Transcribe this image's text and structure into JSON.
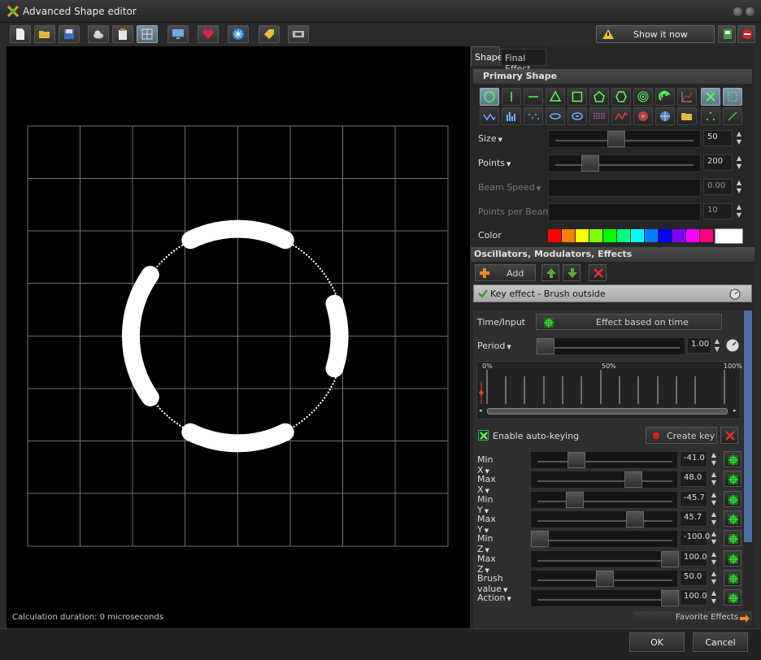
{
  "window": {
    "title": "Advanced Shape editor"
  },
  "toolbar": {
    "buttons": [
      {
        "name": "new-file-icon"
      },
      {
        "name": "open-folder-icon"
      },
      {
        "name": "save-disk-icon"
      },
      {
        "name": "cloud-icon"
      },
      {
        "name": "clipboard-icon"
      },
      {
        "name": "grid-icon"
      },
      {
        "name": "monitor-icon"
      },
      {
        "name": "heart-icon"
      },
      {
        "name": "snowflake-icon"
      },
      {
        "name": "tag-icon"
      },
      {
        "name": "film-icon"
      }
    ],
    "show_label": "Show it now"
  },
  "canvas": {
    "status": "Calculation duration: 0 microseconds"
  },
  "tabs": [
    {
      "label": "Shape"
    },
    {
      "label": "Final Effect"
    }
  ],
  "primary_shape": {
    "header": "Primary Shape",
    "sliders": [
      {
        "label": "Size",
        "value": "50",
        "fraction": 0.45,
        "enabled": true
      },
      {
        "label": "Points",
        "value": "200",
        "fraction": 0.25,
        "enabled": true
      },
      {
        "label": "Beam Speed",
        "value": "0.00",
        "fraction": null,
        "enabled": false
      },
      {
        "label": "Points per Beam",
        "value": "10",
        "fraction": null,
        "enabled": false
      }
    ],
    "color_label": "Color",
    "colors": [
      "#ff0000",
      "#ff7f00",
      "#ffff00",
      "#7fff00",
      "#00ff00",
      "#00ff7f",
      "#00ffff",
      "#007fff",
      "#0000ff",
      "#7f00ff",
      "#ff00ff",
      "#ff007f"
    ],
    "selected_color": "#ffffff"
  },
  "oscillators": {
    "header": "Oscillators, Modulators, Effects",
    "add_label": "Add",
    "effect_item": "Key effect - Brush outside"
  },
  "effect": {
    "time_input_label": "Time/Input",
    "time_mode": "Effect based on time",
    "period_label": "Period",
    "period_value": "1.00",
    "timeline_ticks": [
      "0%",
      "50%",
      "100%"
    ],
    "auto_keying_label": "Enable auto-keying",
    "create_key_label": "Create key",
    "params": [
      {
        "label": "Min X",
        "value": "-41.0",
        "fraction": 0.28
      },
      {
        "label": "Max X",
        "value": "48.0",
        "fraction": 0.72
      },
      {
        "label": "Min Y",
        "value": "-45.7",
        "fraction": 0.27
      },
      {
        "label": "Max Y",
        "value": "45.7",
        "fraction": 0.73
      },
      {
        "label": "Min Z",
        "value": "-100.0",
        "fraction": 0.0
      },
      {
        "label": "Max Z",
        "value": "100.0",
        "fraction": 1.0
      },
      {
        "label": "Brush value",
        "value": "50.0",
        "fraction": 0.5
      },
      {
        "label": "Action",
        "value": "100.0",
        "fraction": 1.0
      }
    ]
  },
  "favorite_label": "Favorite Effects",
  "dialog": {
    "ok_label": "OK",
    "cancel_label": "Cancel"
  }
}
